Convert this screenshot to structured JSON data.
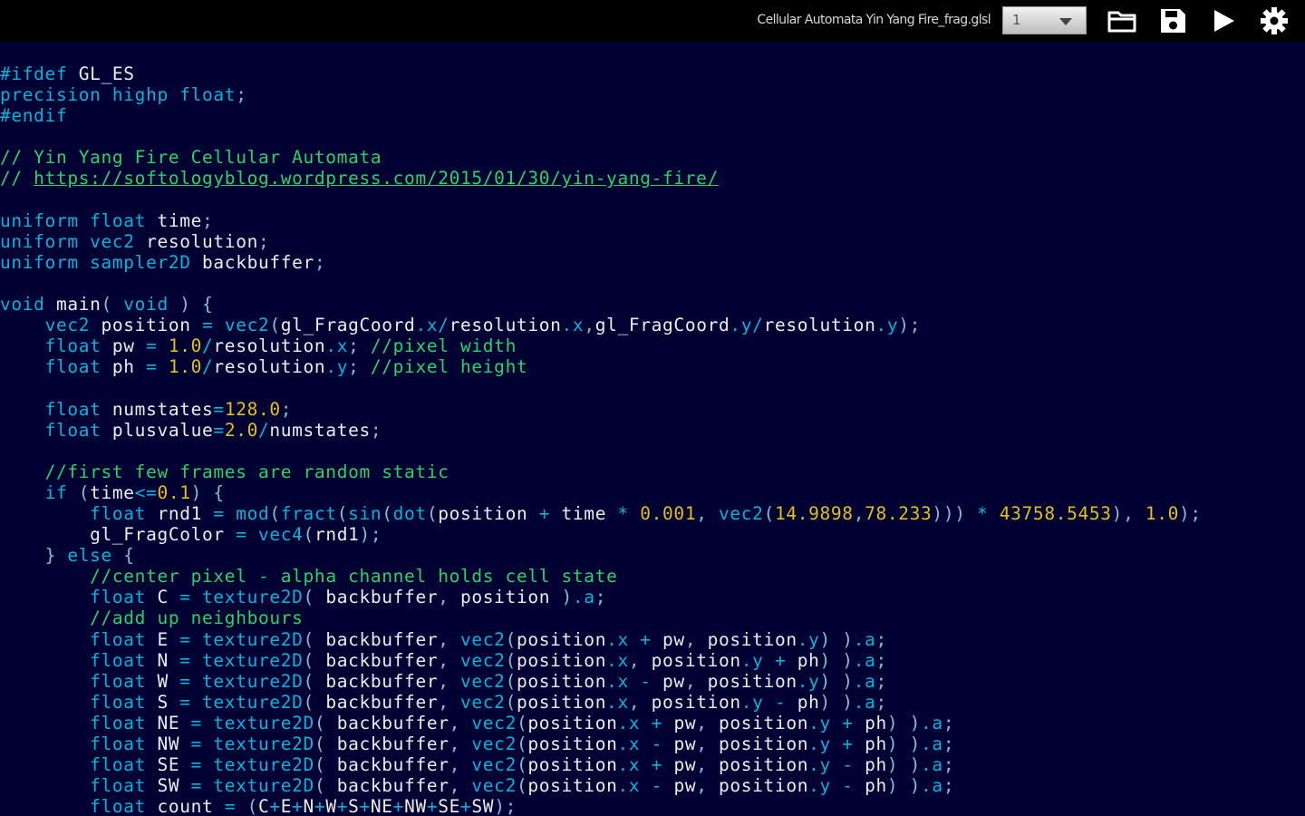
{
  "toolbar": {
    "file_title": "Cellular Automata Yin Yang Fire_frag.glsl",
    "select_value": "1",
    "icons": [
      "folder-open-icon",
      "save-icon",
      "play-icon",
      "settings-gear-icon"
    ]
  },
  "colors": {
    "background": "#000033",
    "keyword": "#00b4dc",
    "number": "#e0c01a",
    "comment": "#25d468",
    "identifier": "#ececec"
  },
  "code": {
    "lines": [
      "#ifdef GL_ES",
      "precision highp float;",
      "#endif",
      "",
      "// Yin Yang Fire Cellular Automata",
      "// https://softologyblog.wordpress.com/2015/01/30/yin-yang-fire/",
      "",
      "uniform float time;",
      "uniform vec2 resolution;",
      "uniform sampler2D backbuffer;",
      "",
      "void main( void ) {",
      "    vec2 position = vec2(gl_FragCoord.x/resolution.x,gl_FragCoord.y/resolution.y);",
      "    float pw = 1.0/resolution.x; //pixel width",
      "    float ph = 1.0/resolution.y; //pixel height",
      "",
      "    float numstates=128.0;",
      "    float plusvalue=2.0/numstates;",
      "",
      "    //first few frames are random static",
      "    if (time<=0.1) {",
      "        float rnd1 = mod(fract(sin(dot(position + time * 0.001, vec2(14.9898,78.233))) * 43758.5453), 1.0);",
      "        gl_FragColor = vec4(rnd1);",
      "    } else {",
      "        //center pixel - alpha channel holds cell state",
      "        float C = texture2D( backbuffer, position ).a;",
      "        //add up neighbours",
      "        float E = texture2D( backbuffer, vec2(position.x + pw, position.y) ).a;",
      "        float N = texture2D( backbuffer, vec2(position.x, position.y + ph) ).a;",
      "        float W = texture2D( backbuffer, vec2(position.x - pw, position.y) ).a;",
      "        float S = texture2D( backbuffer, vec2(position.x, position.y - ph) ).a;",
      "        float NE = texture2D( backbuffer, vec2(position.x + pw, position.y + ph) ).a;",
      "        float NW = texture2D( backbuffer, vec2(position.x - pw, position.y + ph) ).a;",
      "        float SE = texture2D( backbuffer, vec2(position.x + pw, position.y - ph) ).a;",
      "        float SW = texture2D( backbuffer, vec2(position.x - pw, position.y - ph) ).a;",
      "        float count = (C+E+N+W+S+NE+NW+SE+SW);"
    ]
  }
}
